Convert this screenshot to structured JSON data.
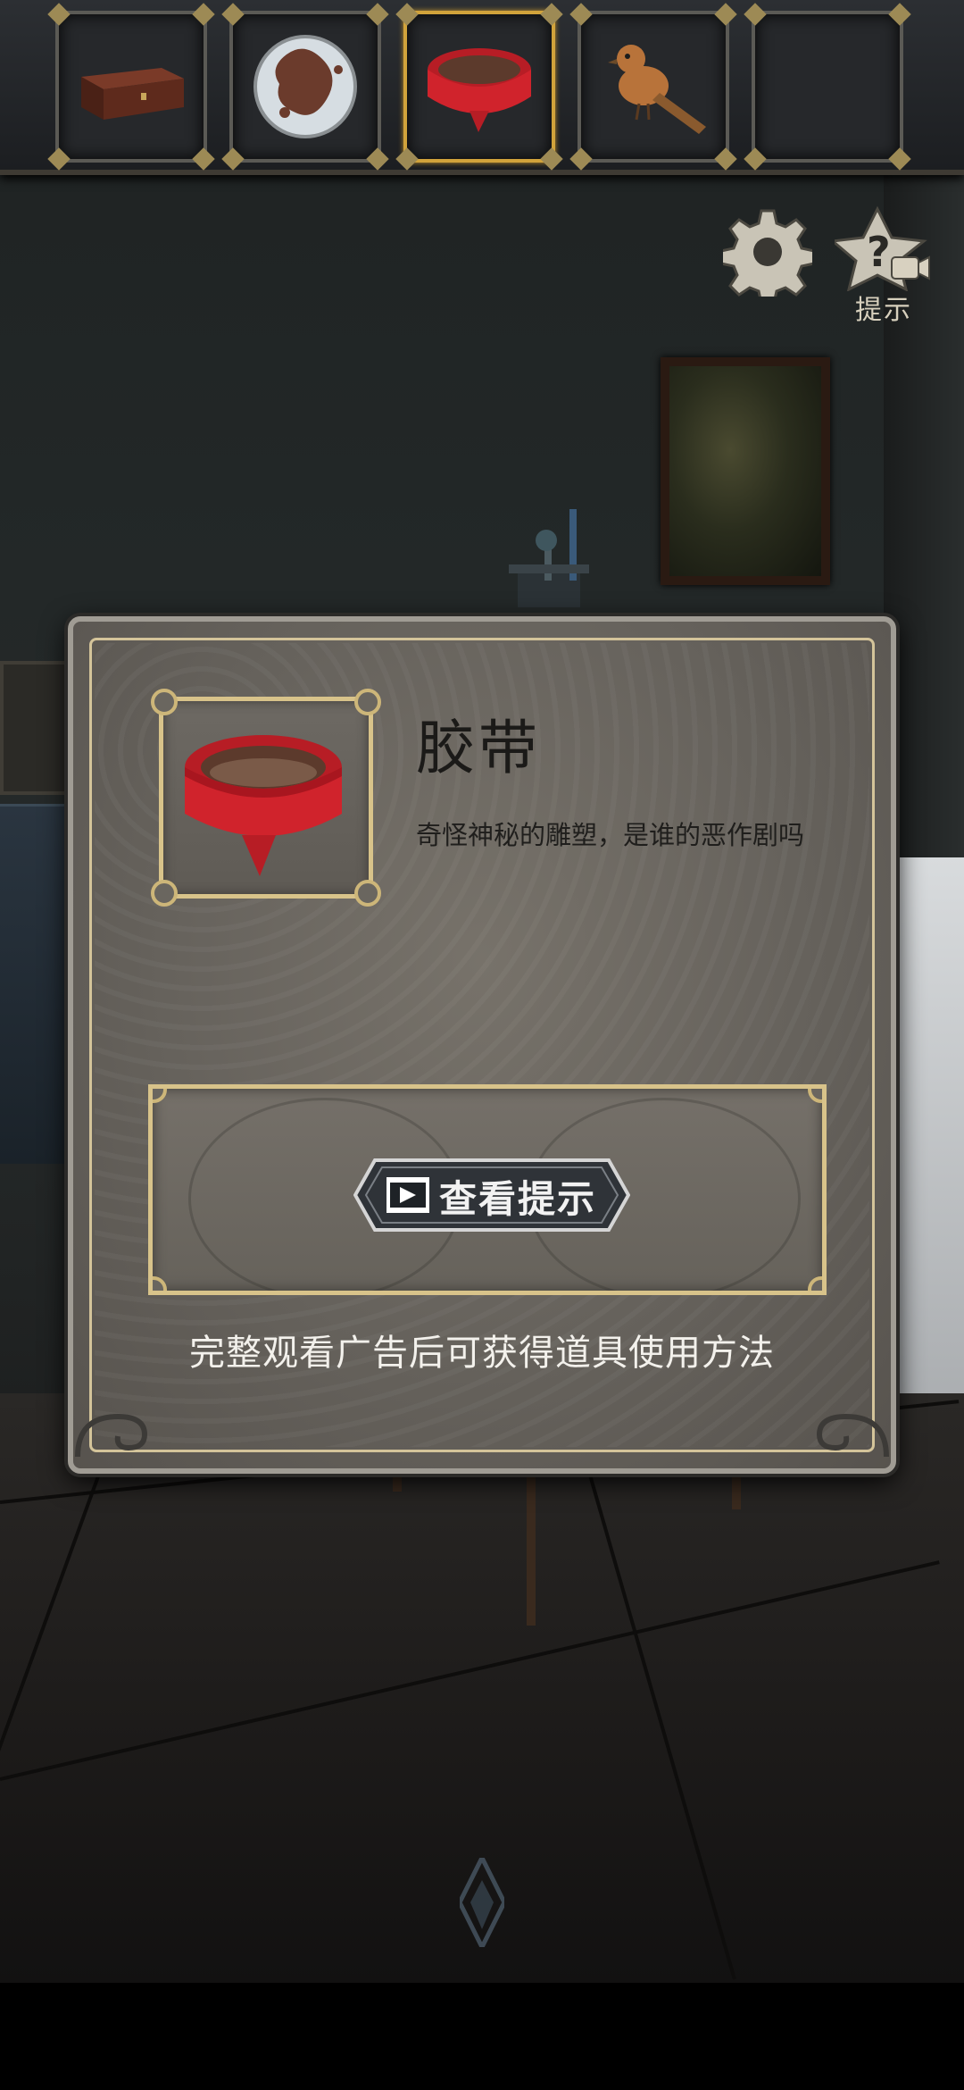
{
  "inventory": {
    "slots": [
      {
        "item": "wooden-box",
        "selected": false
      },
      {
        "item": "stained-disc",
        "selected": false
      },
      {
        "item": "red-tape",
        "selected": true
      },
      {
        "item": "bird-figurine",
        "selected": false
      },
      {
        "item": "empty",
        "selected": false
      }
    ],
    "selected_color": "#d1a33b"
  },
  "controls": {
    "settings_icon": "gear-icon",
    "hint_icon": "question-video-icon",
    "hint_label": "提示"
  },
  "item_dialog": {
    "item_name": "胶带",
    "item_icon": "red-tape-icon",
    "description": "奇怪神秘的雕塑，是谁的恶作剧吗",
    "watch_hint_button": "查看提示",
    "watch_hint_icon": "play-video-icon",
    "ad_note": "完整观看广告后可获得道具使用方法"
  },
  "colors": {
    "frame_gold": "#d8c38a",
    "tape_red": "#c8202a"
  }
}
